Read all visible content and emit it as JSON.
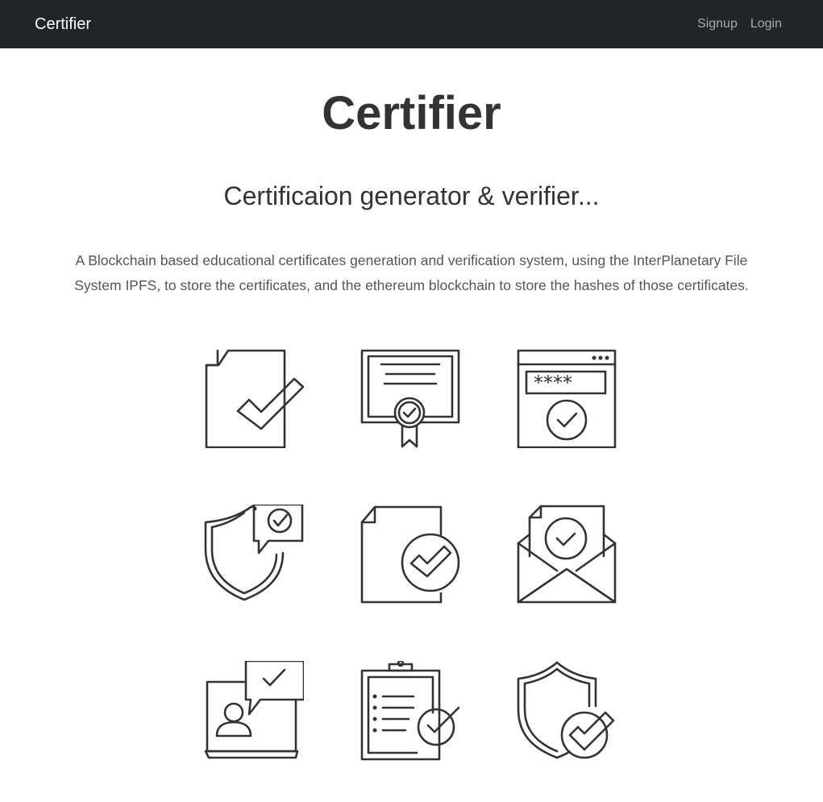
{
  "navbar": {
    "brand": "Certifier",
    "links": [
      {
        "label": "Signup"
      },
      {
        "label": "Login"
      }
    ]
  },
  "hero": {
    "title": "Certifier",
    "subtitle": "Certificaion generator & verifier...",
    "description": "A Blockchain based educational certificates generation and verification system, using the InterPlanetary File System IPFS, to store the certificates, and the ethereum blockchain to store the hashes of those certificates."
  },
  "icons": [
    {
      "name": "document-check-icon"
    },
    {
      "name": "certificate-badge-icon"
    },
    {
      "name": "password-browser-check-icon"
    },
    {
      "name": "shield-message-check-icon"
    },
    {
      "name": "document-circle-check-icon"
    },
    {
      "name": "envelope-letter-check-icon"
    },
    {
      "name": "user-laptop-message-check-icon"
    },
    {
      "name": "clipboard-checklist-icon"
    },
    {
      "name": "shield-circle-check-icon"
    }
  ]
}
